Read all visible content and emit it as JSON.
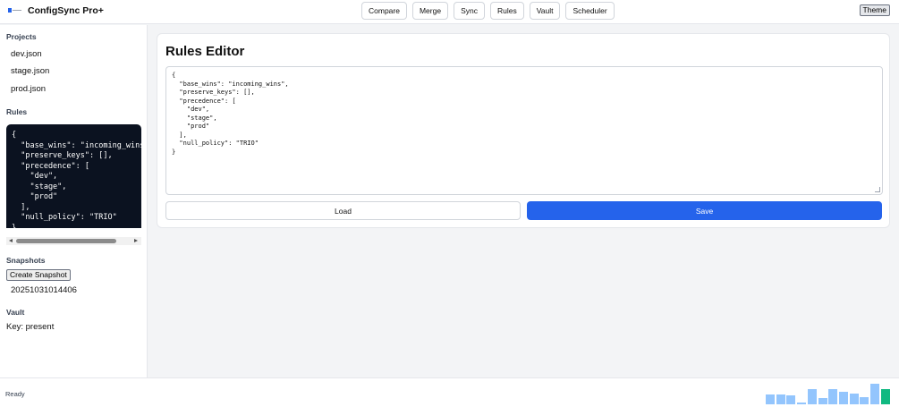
{
  "app": {
    "title": "ConfigSync Pro+"
  },
  "nav": [
    "Compare",
    "Merge",
    "Sync",
    "Rules",
    "Vault",
    "Scheduler"
  ],
  "header": {
    "theme_label": "Theme"
  },
  "sidebar": {
    "projects_title": "Projects",
    "projects": [
      "dev.json",
      "stage.json",
      "prod.json"
    ],
    "rules_title": "Rules",
    "rules_code": "{\n  \"base_wins\": \"incoming_wins\",\n  \"preserve_keys\": [],\n  \"precedence\": [\n    \"dev\",\n    \"stage\",\n    \"prod\"\n  ],\n  \"null_policy\": \"TRIO\"\n}",
    "snapshots_title": "Snapshots",
    "create_snapshot_label": "Create Snapshot",
    "snapshots": [
      "20251031014406"
    ],
    "vault_title": "Vault",
    "vault_status": "Key: present"
  },
  "editor": {
    "title": "Rules Editor",
    "content": "{\n  \"base_wins\": \"incoming_wins\",\n  \"preserve_keys\": [],\n  \"precedence\": [\n    \"dev\",\n    \"stage\",\n    \"prod\"\n  ],\n  \"null_policy\": \"TRIO\"\n}",
    "load_label": "Load",
    "save_label": "Save"
  },
  "status": {
    "text": "Ready",
    "activity_levels": [
      0.45,
      0.45,
      0.4,
      0.08,
      0.72,
      0.3,
      0.7,
      0.6,
      0.5,
      0.35,
      0.95,
      0.7
    ]
  },
  "colors": {
    "accent": "#2563eb",
    "sidebar_code_bg": "#0b1220",
    "spark_bar": "#93c5fd",
    "spark_last": "#10b981"
  }
}
